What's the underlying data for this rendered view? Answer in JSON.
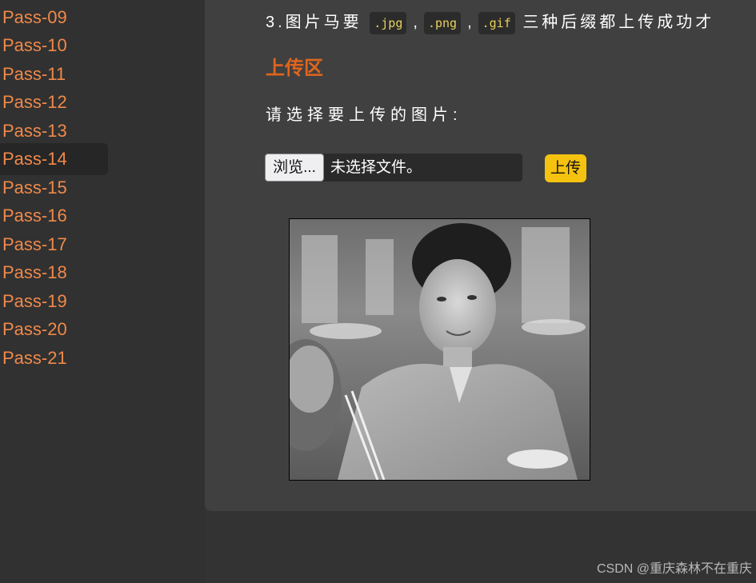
{
  "sidebar": {
    "items": [
      {
        "label": "Pass-09"
      },
      {
        "label": "Pass-10"
      },
      {
        "label": "Pass-11"
      },
      {
        "label": "Pass-12"
      },
      {
        "label": "Pass-13"
      },
      {
        "label": "Pass-14",
        "active": true
      },
      {
        "label": "Pass-15"
      },
      {
        "label": "Pass-16"
      },
      {
        "label": "Pass-17"
      },
      {
        "label": "Pass-18"
      },
      {
        "label": "Pass-19"
      },
      {
        "label": "Pass-20"
      },
      {
        "label": "Pass-21"
      }
    ],
    "link_color": "#f0894a"
  },
  "main": {
    "instruction": {
      "prefix": "3.图片马要",
      "ext1": ".jpg",
      "ext2": ".png",
      "ext3": ".gif",
      "separator": ",",
      "suffix": "三种后缀都上传成功才"
    },
    "section_title": "上传区",
    "prompt": "请选择要上传的图片:",
    "file_input": {
      "button_label": "浏览...",
      "status": "未选择文件。"
    },
    "upload_button": "上传",
    "accent_color": "#e0651e",
    "button_color": "#f5c210"
  },
  "watermark": "CSDN @重庆森林不在重庆"
}
